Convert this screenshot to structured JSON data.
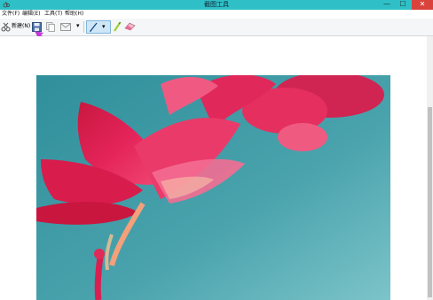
{
  "window": {
    "title": "截图工具",
    "min_glyph": "—",
    "max_glyph": "☐",
    "close_glyph": "✕"
  },
  "menu": {
    "items": [
      {
        "label": "文件(F)"
      },
      {
        "label": "编辑(E)"
      },
      {
        "label": "工具(T)"
      },
      {
        "label": "帮助(H)"
      }
    ]
  },
  "toolbar": {
    "new_label": "新建(N)",
    "dropdown_glyph": "▾"
  },
  "colors": {
    "titlebar": "#2ec0c6",
    "sky": "#4aa3ad",
    "flower": "#e4245a",
    "annotation_arrow": "#c03ad6"
  }
}
